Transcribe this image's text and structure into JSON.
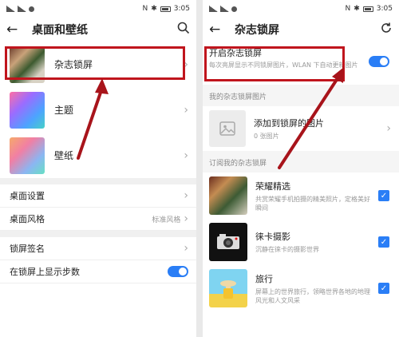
{
  "left": {
    "status": {
      "time": "3:05",
      "battery": "",
      "icons": [
        "N",
        "✱"
      ]
    },
    "header": {
      "title": "桌面和壁纸"
    },
    "big_items": [
      {
        "label": "杂志锁屏"
      },
      {
        "label": "主题"
      },
      {
        "label": "壁纸"
      }
    ],
    "rows": [
      {
        "label": "桌面设置",
        "value": ""
      },
      {
        "label": "桌面风格",
        "value": "标准风格"
      },
      {
        "label": "锁屏签名",
        "value": ""
      },
      {
        "label": "在锁屏上显示步数",
        "value": ""
      }
    ]
  },
  "right": {
    "status": {
      "time": "3:05"
    },
    "header": {
      "title": "杂志锁屏"
    },
    "toggle_item": {
      "title": "开启杂志锁屏",
      "subtitle": "每次亮屏显示不同锁屏图片，WLAN 下自动更新图片"
    },
    "section_my": "我的杂志锁屏图片",
    "add_item": {
      "title": "添加到锁屏的图片",
      "count": "0 张图片"
    },
    "section_sub": "订阅我的杂志锁屏",
    "subscriptions": [
      {
        "title": "荣耀精选",
        "desc": "共赏荣耀手机拍摄的精美照片，定格美好瞬间"
      },
      {
        "title": "徕卡摄影",
        "desc": "沉静在徕卡的摄影世界"
      },
      {
        "title": "旅行",
        "desc": "屏幕上的世界旅行，领略世界各地的地理风光和人文风采"
      }
    ]
  },
  "colors": {
    "accent": "#2a7ef6",
    "annotation": "#c0151d"
  }
}
